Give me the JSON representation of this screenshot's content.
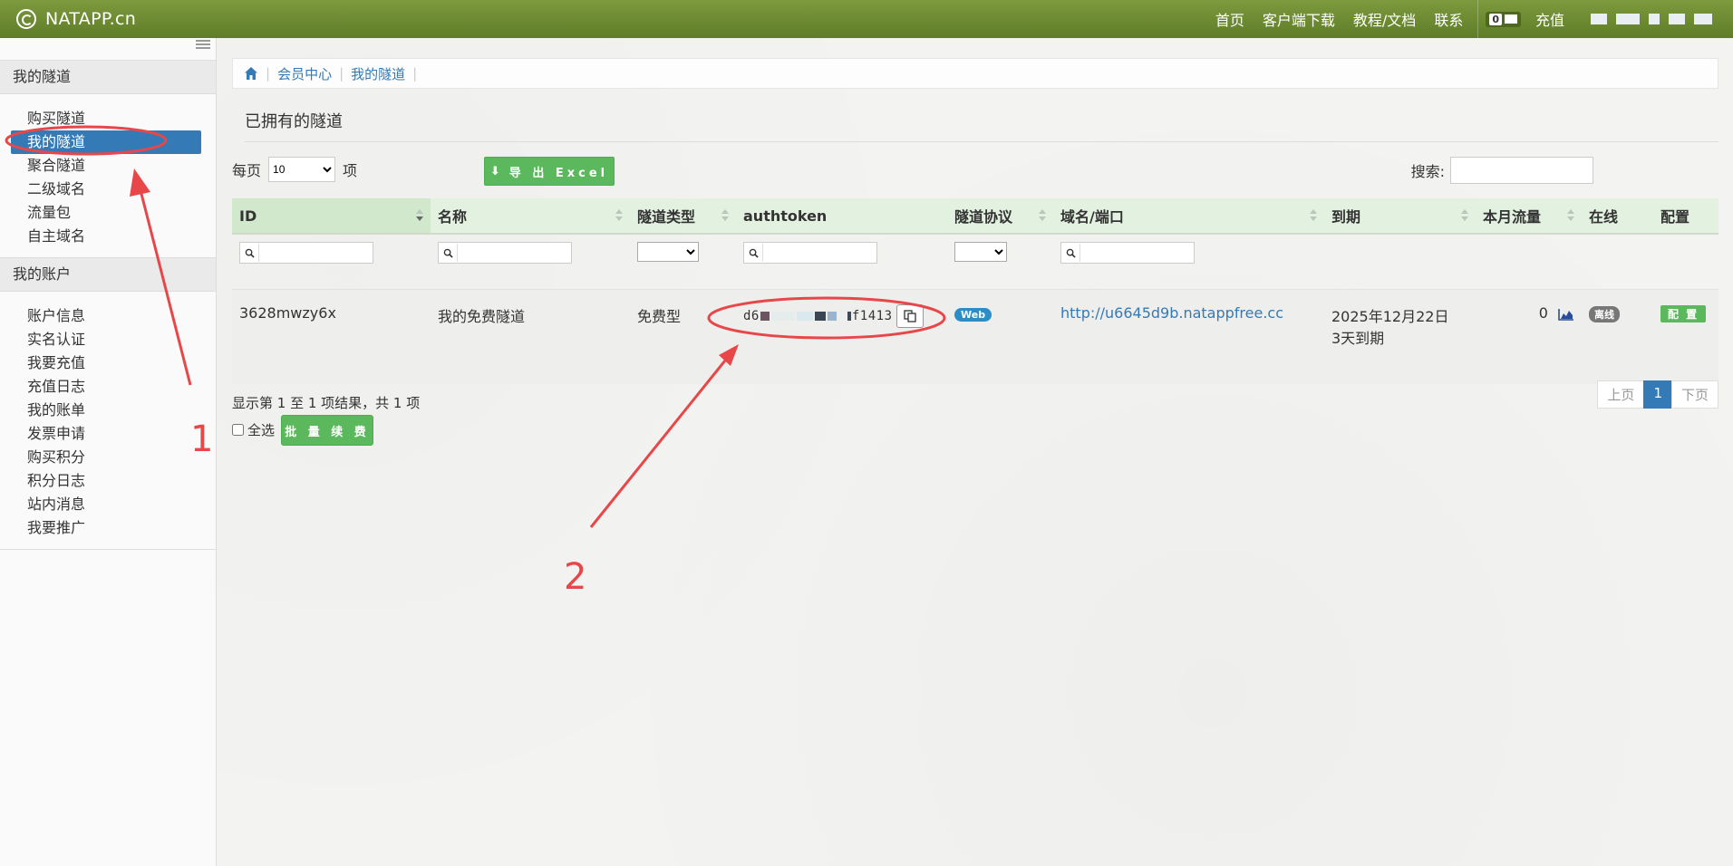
{
  "brand": {
    "name": "NATAPP.cn"
  },
  "topnav": {
    "links": [
      "首页",
      "客户端下载",
      "教程/文档",
      "联系"
    ],
    "message_count": "0",
    "recharge": "充值"
  },
  "sidebar": {
    "sections": [
      {
        "title": "我的隧道",
        "items": [
          "购买隧道",
          "我的隧道",
          "聚合隧道",
          "二级域名",
          "流量包",
          "自主域名"
        ],
        "active": "我的隧道"
      },
      {
        "title": "我的账户",
        "items": [
          "账户信息",
          "实名认证",
          "我要充值",
          "充值日志",
          "我的账单",
          "发票申请",
          "购买积分",
          "积分日志",
          "站内消息",
          "我要推广"
        ]
      }
    ]
  },
  "breadcrumb": [
    "会员中心",
    "我的隧道"
  ],
  "page": {
    "title": "已拥有的隧道"
  },
  "controls": {
    "per_page_label": "每页",
    "per_page_value": "10",
    "per_page_suffix": "项",
    "export_label": "导 出 Excel",
    "search_label": "搜索:"
  },
  "table": {
    "columns": [
      "ID",
      "名称",
      "隧道类型",
      "authtoken",
      "隧道协议",
      "域名/端口",
      "到期",
      "本月流量",
      "在线",
      "配置"
    ],
    "rows": [
      {
        "id": "3628mwzy6x",
        "name": "我的免费隧道",
        "type": "免费型",
        "authtoken_start": "d6",
        "authtoken_end": "f1413",
        "protocol": "Web",
        "domain": "http://u6645d9b.natappfree.cc",
        "expire_date": "2025年12月22日",
        "expire_note": "3天到期",
        "traffic": "0",
        "online": "离线",
        "config": "配 置"
      }
    ]
  },
  "footer": {
    "info": "显示第 1 至 1 项结果，共 1 项",
    "select_all": "全选",
    "renew": "批 量 续 费",
    "pager": {
      "prev": "上页",
      "current": "1",
      "next": "下页"
    }
  },
  "annotations": [
    "1",
    "2"
  ],
  "colors": {
    "topbar": "#6b8a31",
    "accent": "#337ab7",
    "success": "#5cb85c",
    "annotation": "#e8474a"
  }
}
